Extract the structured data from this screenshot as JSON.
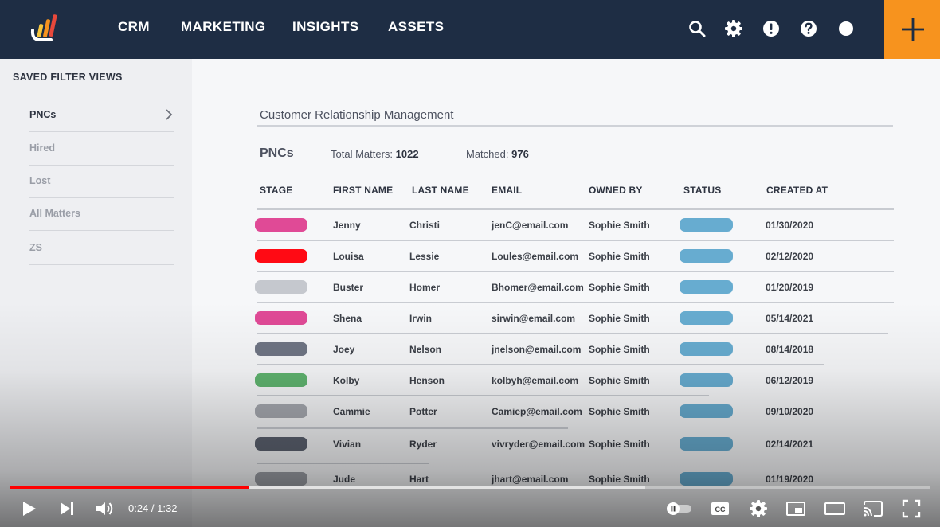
{
  "nav": {
    "items": [
      "CRM",
      "MARKETING",
      "INSIGHTS",
      "ASSETS"
    ],
    "icons": [
      "search-icon",
      "gear-icon",
      "alert-icon",
      "help-icon",
      "profile-icon"
    ],
    "add_icon": "plus-icon",
    "accent_color": "#f7931e",
    "bg_color": "#1e2d44"
  },
  "sidebar": {
    "title": "SAVED FILTER VIEWS",
    "items": [
      {
        "label": "PNCs",
        "active": true
      },
      {
        "label": "Hired",
        "active": false
      },
      {
        "label": "Lost",
        "active": false
      },
      {
        "label": "All Matters",
        "active": false
      },
      {
        "label": "ZS",
        "active": false
      }
    ]
  },
  "main": {
    "title": "Customer Relationship Management",
    "view_name": "PNCs",
    "total_label": "Total Matters:",
    "total_value": "1022",
    "matched_label": "Matched:",
    "matched_value": "976",
    "columns": [
      "STAGE",
      "FIRST NAME",
      "LAST NAME",
      "EMAIL",
      "OWNED BY",
      "STATUS",
      "CREATED AT"
    ],
    "rows": [
      {
        "stage_color": "#e04a96",
        "first": "Jenny",
        "last": "Christi",
        "email": "jenC@email.com",
        "owner": "Sophie Smith",
        "created": "01/30/2020"
      },
      {
        "stage_color": "#ff0a14",
        "first": "Louisa",
        "last": "Lessie",
        "email": "Loules@email.com",
        "owner": "Sophie Smith",
        "created": "02/12/2020"
      },
      {
        "stage_color": "#c5c8ce",
        "first": "Buster",
        "last": "Homer",
        "email": "Bhomer@email.com",
        "owner": "Sophie Smith",
        "created": "01/20/2019"
      },
      {
        "stage_color": "#e04a96",
        "first": "Shena",
        "last": "Irwin",
        "email": "sirwin@email.com",
        "owner": "Sophie Smith",
        "created": "05/14/2021"
      },
      {
        "stage_color": "#6f7584",
        "first": "Joey",
        "last": "Nelson",
        "email": "jnelson@email.com",
        "owner": "Sophie Smith",
        "created": "08/14/2018"
      },
      {
        "stage_color": "#5fb36f",
        "first": "Kolby",
        "last": "Henson",
        "email": "kolbyh@email.com",
        "owner": "Sophie Smith",
        "created": "06/12/2019"
      },
      {
        "stage_color": "#a6a9b0",
        "first": "Cammie",
        "last": "Potter",
        "email": "Camiep@email.com",
        "owner": "Sophie Smith",
        "created": "09/10/2020"
      },
      {
        "stage_color": "#5c6270",
        "first": "Vivian",
        "last": "Ryder",
        "email": "vivryder@email.com",
        "owner": "Sophie Smith",
        "created": "02/14/2021"
      },
      {
        "stage_color": "#9a9da4",
        "first": "Jude",
        "last": "Hart",
        "email": "jhart@email.com",
        "owner": "Sophie Smith",
        "created": "01/19/2020"
      }
    ],
    "status_color": "#67acd0"
  },
  "player": {
    "time": "0:24 / 1:32",
    "played_fraction": 0.26,
    "buffered_fraction": 0.69,
    "icons": [
      "play-icon",
      "next-icon",
      "volume-icon",
      "autoplay-toggle-icon",
      "captions-icon",
      "settings-icon",
      "miniplayer-icon",
      "theater-icon",
      "cast-icon",
      "fullscreen-icon"
    ]
  }
}
